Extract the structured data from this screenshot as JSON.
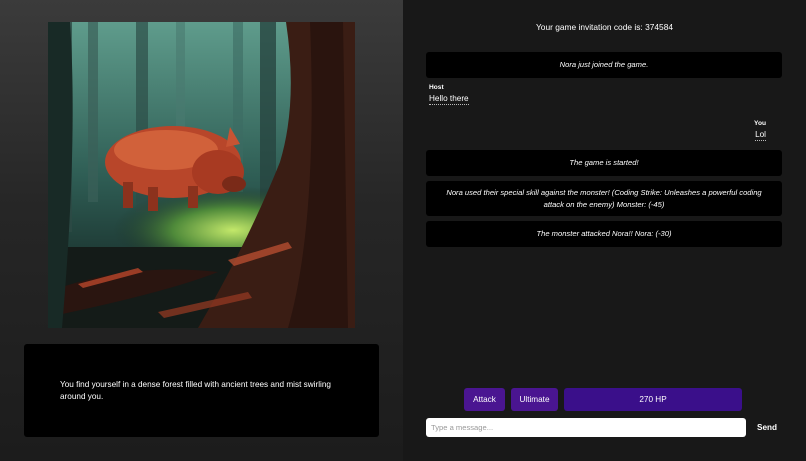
{
  "story": {
    "narration": "You find yourself in a dense forest filled with ancient trees and mist swirling around you."
  },
  "header": {
    "invitation_text": "Your game invitation code is: 374584"
  },
  "chat": {
    "system_joined": "Nora just joined the game.",
    "host_author": "Host",
    "host_text": "Hello there",
    "you_author": "You",
    "you_text": "Lol",
    "system_started": "The game is started!",
    "system_skill": "Nora used their special skill against the monster! (Coding Strike: Unleashes a powerful coding attack on the enemy) Monster: (-45)",
    "system_monster": "The monster attacked Nora!! Nora: (-30)"
  },
  "actions": {
    "attack_label": "Attack",
    "ultimate_label": "Ultimate",
    "hp_label": "270 HP"
  },
  "composer": {
    "placeholder": "Type a message...",
    "send_label": "Send"
  },
  "colors": {
    "button_purple": "#4a1591",
    "hp_purple": "#3a0f8a"
  }
}
